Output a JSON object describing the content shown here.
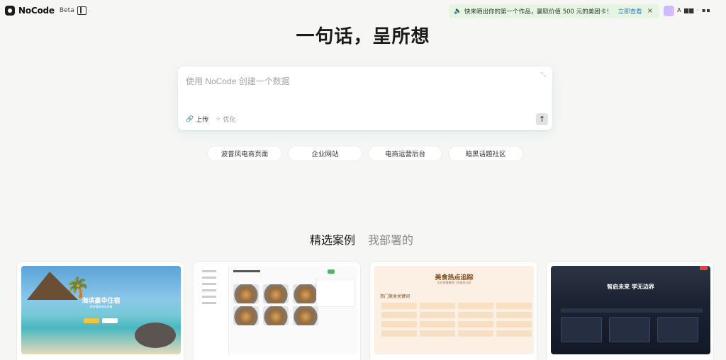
{
  "app": {
    "name": "NoCode",
    "badge": "Beta"
  },
  "notice": {
    "text": "快来晒出你的第一个作品，赢取价值 500 元的美团卡！",
    "link": "立即查看",
    "close": "×"
  },
  "user": {
    "name": "A ▆▆  ·  ▪▪"
  },
  "hero": {
    "title": "一句话，呈所想"
  },
  "prompt": {
    "placeholder": "使用 NoCode 创建一个数据",
    "upload_label": "上传",
    "optimize_label": "优化",
    "send_icon": "↑"
  },
  "suggestions": [
    {
      "label": "波普风电商页面"
    },
    {
      "label": "企业网站"
    },
    {
      "label": "电商运营后台"
    },
    {
      "label": "暗黑话题社区"
    }
  ],
  "tabs": [
    {
      "label": "精选案例",
      "active": true
    },
    {
      "label": "我部署的",
      "active": false
    }
  ],
  "cards": [
    {
      "name": "海滨豪华住宿",
      "thumb_title": "海滨豪华住宿",
      "thumb_sub": "体验极致海岛风情"
    },
    {
      "name": "",
      "thumb_title": "",
      "thumb_sub": ""
    },
    {
      "name": "",
      "thumb_title": "美食热点追踪",
      "thumb_sub": "实时掌握最热门的美食动态",
      "section": "热门美食关键词"
    },
    {
      "name": "",
      "thumb_title": "智启未来 学无边界",
      "thumb_sub": ""
    }
  ],
  "colors": {
    "background": "#f6f6f5",
    "notice_bg": "#e6f4e3",
    "notice_link": "#2f7ad6"
  },
  "icons": {
    "logo": "nocode-logo-icon",
    "sidebar": "sidebar-toggle-icon",
    "speaker": "speaker-icon",
    "upload": "paperclip-icon",
    "optimize": "sparkle-icon",
    "expand": "expand-icon",
    "send": "arrow-up-icon"
  }
}
